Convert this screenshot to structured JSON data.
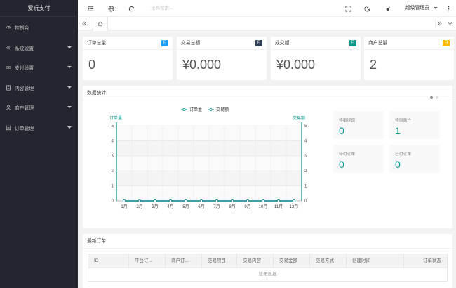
{
  "app": {
    "title": "爱玩支付"
  },
  "sidebar": {
    "items": [
      {
        "label": "控制台",
        "icon": "dashboard-icon",
        "expandable": false
      },
      {
        "label": "系统设置",
        "icon": "gear-icon",
        "expandable": true
      },
      {
        "label": "支付设置",
        "icon": "link-icon",
        "expandable": true
      },
      {
        "label": "内容管理",
        "icon": "document-icon",
        "expandable": true
      },
      {
        "label": "商户管理",
        "icon": "user-icon",
        "expandable": true
      },
      {
        "label": "订单管理",
        "icon": "list-icon",
        "expandable": true
      }
    ]
  },
  "header": {
    "search_placeholder": "全局搜索...",
    "admin_label": "超级管理员",
    "icons": [
      "collapse-menu-icon",
      "globe-icon",
      "refresh-icon",
      "fullscreen-icon",
      "theme-icon",
      "clean-icon",
      "more-icon"
    ]
  },
  "stats": [
    {
      "label": "订单总量",
      "badge": "月",
      "value": "0",
      "badge_color": "#1e9fff"
    },
    {
      "label": "交易总额",
      "badge": "月",
      "value": "¥0.000",
      "badge_color": "#2f4056"
    },
    {
      "label": "成交额",
      "badge": "月",
      "value": "¥0.000",
      "badge_color": "#009688"
    },
    {
      "label": "商户总量",
      "badge": "月",
      "value": "2",
      "badge_color": "#ffb800"
    }
  ],
  "data_panel": {
    "title": "数据统计",
    "mini": [
      {
        "label": "待审提现",
        "value": "0"
      },
      {
        "label": "待审商户",
        "value": "1"
      },
      {
        "label": "待付订单",
        "value": "0"
      },
      {
        "label": "已付订单",
        "value": "0"
      }
    ]
  },
  "chart_data": {
    "type": "line",
    "categories": [
      "1月",
      "2月",
      "3月",
      "4月",
      "5月",
      "6月",
      "7月",
      "8月",
      "9月",
      "10月",
      "11月",
      "12月"
    ],
    "series": [
      {
        "name": "订单量",
        "values": [
          0,
          0,
          0,
          0,
          0,
          0,
          0,
          0,
          0,
          0,
          0,
          0
        ]
      },
      {
        "name": "交易额",
        "values": [
          0,
          0,
          0,
          0,
          0,
          0,
          0,
          0,
          0,
          0,
          0,
          0
        ]
      }
    ],
    "ylabel_left": "订单量",
    "ylabel_right": "交易额",
    "ylim": [
      0,
      5
    ],
    "yticks": [
      0,
      1,
      2,
      3,
      4,
      5
    ],
    "legend_position": "top-center",
    "grid": true,
    "colors": [
      "#009688",
      "#2f8f9d"
    ]
  },
  "orders": {
    "title": "最新订单",
    "columns": [
      "ID",
      "平台订...",
      "商户订...",
      "交易项目",
      "交易内容",
      "交易金额",
      "交易方式",
      "创建时间",
      "订单状态"
    ],
    "empty_text": "暂无数据"
  },
  "colors": {
    "sidebar_bg": "#23262e",
    "accent": "#009688"
  }
}
